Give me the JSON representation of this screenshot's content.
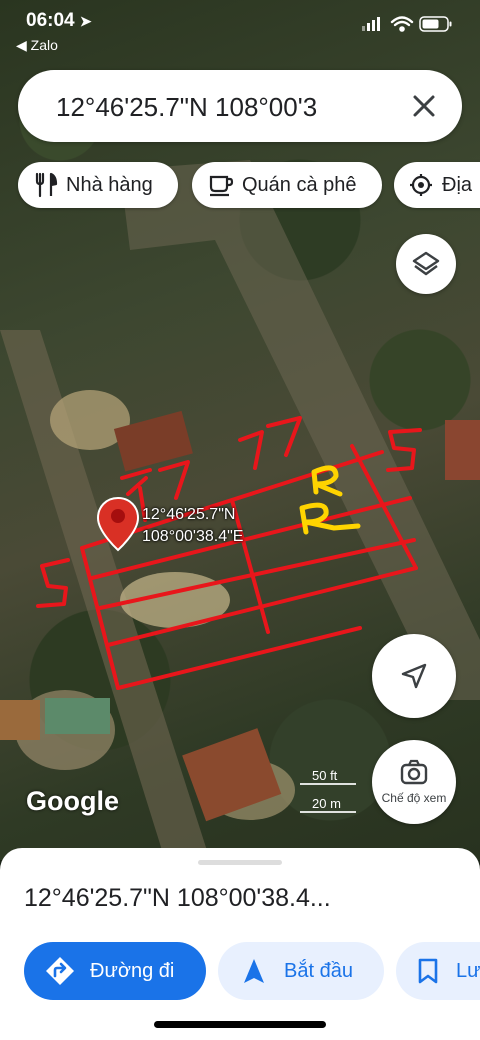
{
  "status_bar": {
    "time": "06:04",
    "back_app": "◀ Zalo"
  },
  "search": {
    "value": "12°46'25.7\"N 108°00'3"
  },
  "chips": [
    {
      "label": "Nhà hàng",
      "icon": "restaurant-icon"
    },
    {
      "label": "Quán cà phê",
      "icon": "coffee-icon"
    },
    {
      "label": "Địa",
      "icon": "attraction-icon"
    }
  ],
  "map": {
    "pin_label_line1": "12°46'25.7\"N",
    "pin_label_line2": "108°00'38.4\"E",
    "scale_top": "50 ft",
    "scale_bottom": "20 m",
    "annotation_numbers": [
      "27",
      "27",
      "5",
      "5"
    ],
    "annotation_letter": "R",
    "brand": "Google",
    "view_mode_label": "Chế độ xem"
  },
  "sheet": {
    "title": "12°46'25.7\"N 108°00'38.4...",
    "directions_label": "Đường đi",
    "start_label": "Bắt đầu",
    "save_label": "Lưu"
  },
  "colors": {
    "accent": "#1a73e8",
    "annotation_red": "#e8161b",
    "annotation_yellow": "#ffd400",
    "pin_red": "#d93025"
  }
}
